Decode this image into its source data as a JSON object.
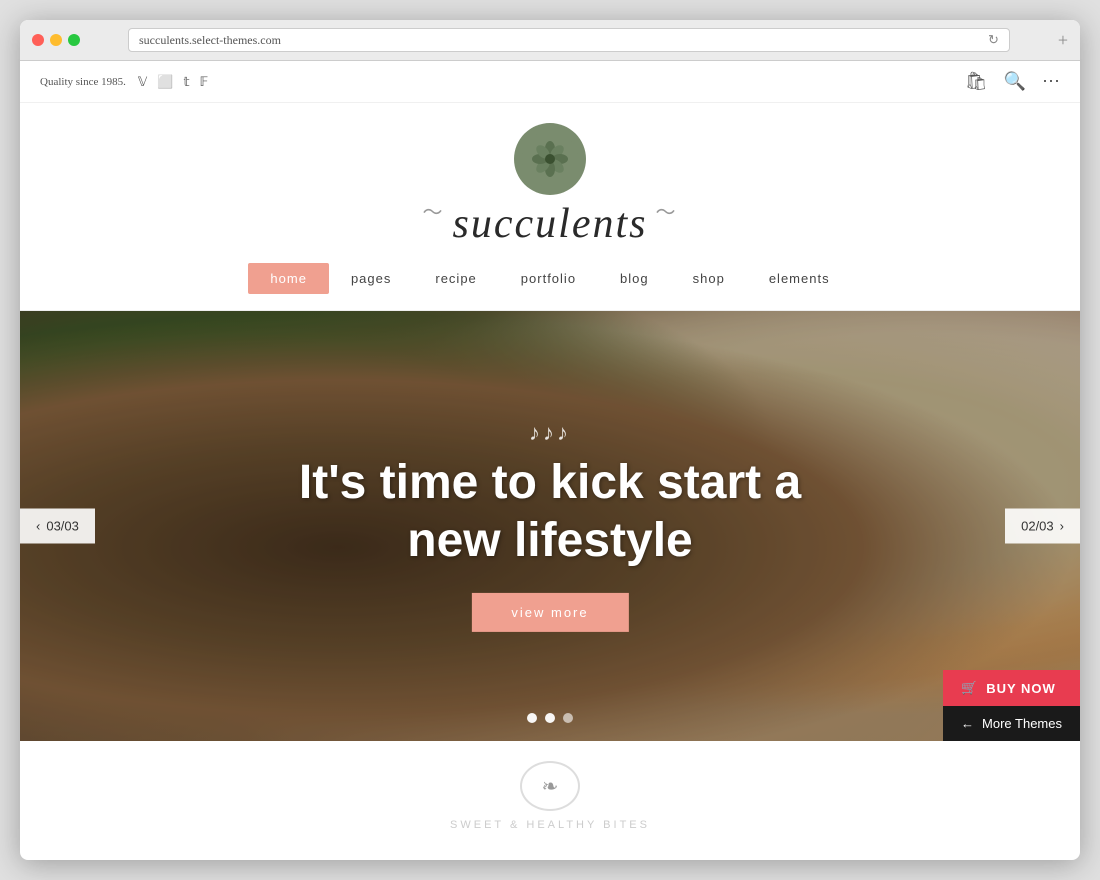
{
  "browser": {
    "url": "succulents.select-themes.com",
    "new_tab_label": "+",
    "reload_icon": "↻"
  },
  "topbar": {
    "tagline": "Quality since 1985.",
    "social_icons": [
      "v",
      "◻",
      "t",
      "f"
    ]
  },
  "logo": {
    "site_name": "succulents"
  },
  "nav": {
    "items": [
      {
        "label": "home",
        "active": true
      },
      {
        "label": "pages",
        "active": false
      },
      {
        "label": "recipe",
        "active": false
      },
      {
        "label": "portfolio",
        "active": false
      },
      {
        "label": "blog",
        "active": false
      },
      {
        "label": "shop",
        "active": false
      },
      {
        "label": "elements",
        "active": false
      }
    ]
  },
  "hero": {
    "script_text": "♪♪♪",
    "title_line1": "It's time to kick start a",
    "title_line2": "new lifestyle",
    "cta_label": "view more",
    "prev_label": "03/03",
    "next_label": "02/03",
    "dots": [
      true,
      true,
      false
    ]
  },
  "floating": {
    "buy_now_label": "BUY NOW",
    "more_themes_label": "More Themes",
    "back_arrow": "←"
  },
  "below_fold": {
    "text": "SWEET & HEALTHY BITES"
  }
}
